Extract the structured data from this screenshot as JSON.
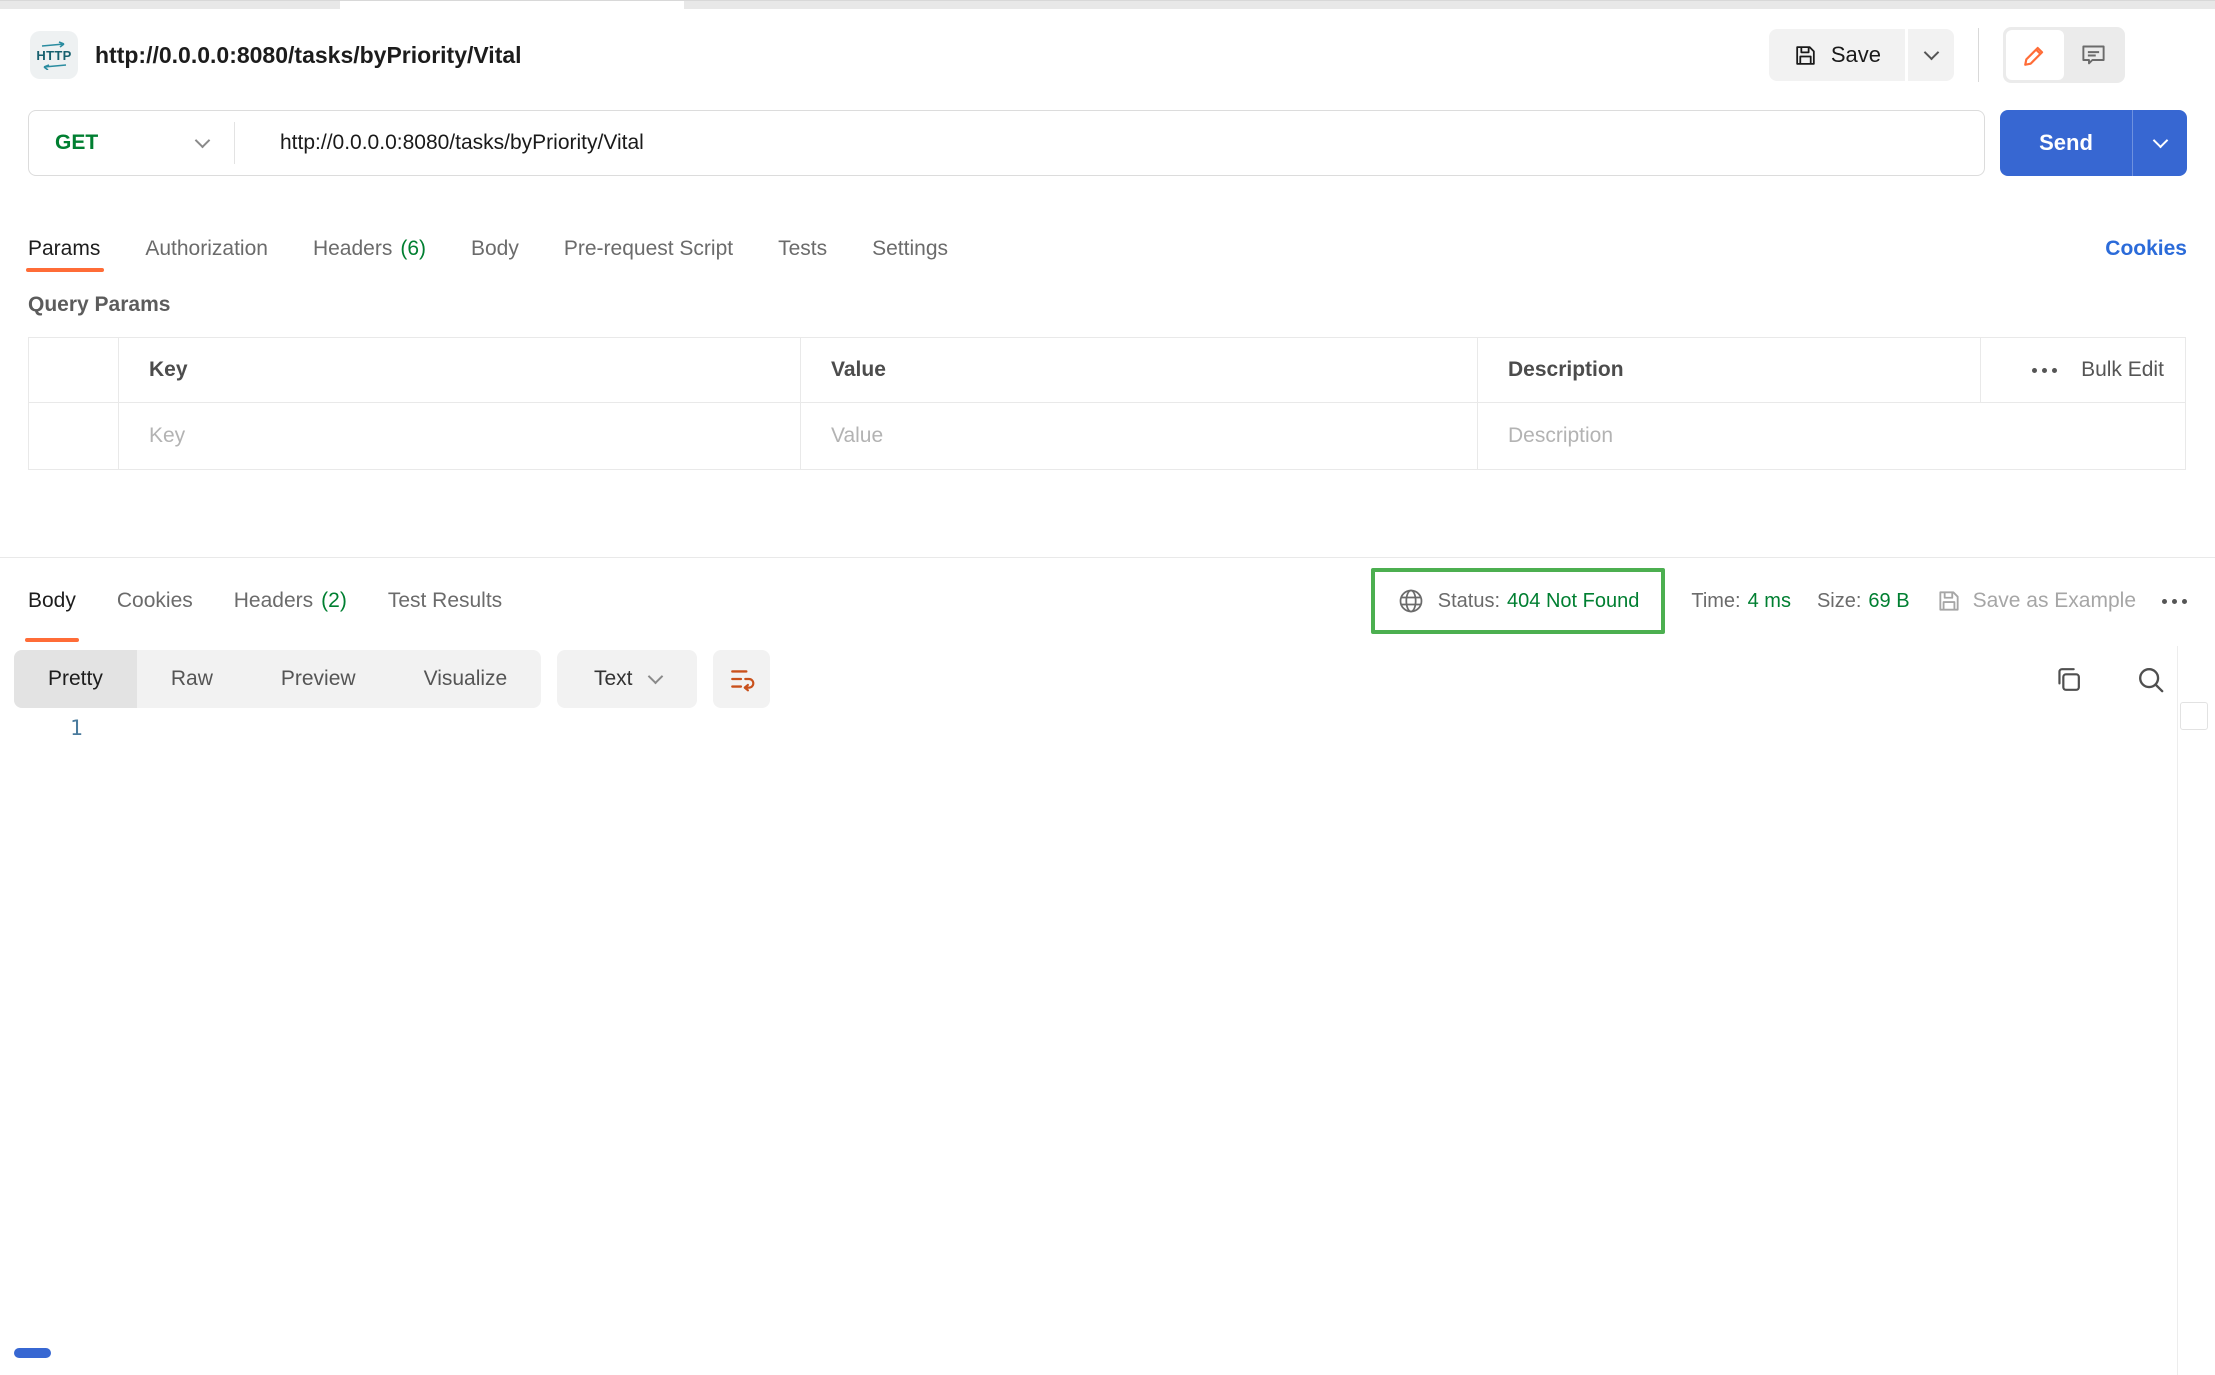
{
  "header": {
    "method_badge": "HTTP",
    "title": "http://0.0.0.0:8080/tasks/byPriority/Vital",
    "save_label": "Save"
  },
  "request_bar": {
    "method": "GET",
    "url": "http://0.0.0.0:8080/tasks/byPriority/Vital",
    "send_label": "Send"
  },
  "request_tabs": {
    "items": [
      {
        "label": "Params",
        "active": true
      },
      {
        "label": "Authorization",
        "active": false
      },
      {
        "label": "Headers",
        "count": "(6)",
        "active": false
      },
      {
        "label": "Body",
        "active": false
      },
      {
        "label": "Pre-request Script",
        "active": false
      },
      {
        "label": "Tests",
        "active": false
      },
      {
        "label": "Settings",
        "active": false
      }
    ],
    "cookies_link": "Cookies"
  },
  "query_params": {
    "section_title": "Query Params",
    "columns": {
      "key": "Key",
      "value": "Value",
      "description": "Description"
    },
    "bulk_edit_label": "Bulk Edit",
    "row_placeholders": {
      "key": "Key",
      "value": "Value",
      "description": "Description"
    }
  },
  "response": {
    "tabs": [
      {
        "label": "Body",
        "active": true
      },
      {
        "label": "Cookies",
        "active": false
      },
      {
        "label": "Headers",
        "count": "(2)",
        "active": false
      },
      {
        "label": "Test Results",
        "active": false
      }
    ],
    "status_label": "Status:",
    "status_value": "404 Not Found",
    "time_label": "Time:",
    "time_value": "4 ms",
    "size_label": "Size:",
    "size_value": "69 B",
    "save_as_example_label": "Save as Example",
    "view_tabs": [
      {
        "label": "Pretty",
        "active": true
      },
      {
        "label": "Raw",
        "active": false
      },
      {
        "label": "Preview",
        "active": false
      },
      {
        "label": "Visualize",
        "active": false
      }
    ],
    "format_selector": "Text",
    "line_number": "1"
  },
  "colors": {
    "accent_orange": "#ff6c37",
    "green": "#007f31",
    "status_box_green": "#4caf50",
    "send_blue": "#3767d2",
    "link_blue": "#2b6bd9",
    "line_number_blue": "#4a7b9d"
  }
}
